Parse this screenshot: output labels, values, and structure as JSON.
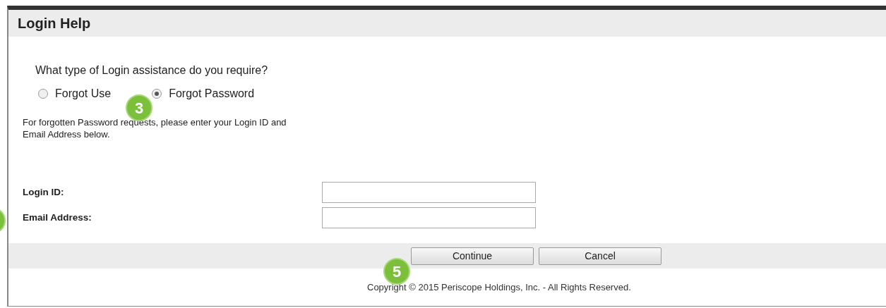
{
  "window": {
    "title": "Login Help"
  },
  "question": "What type of Login assistance do you require?",
  "options": [
    {
      "label": "Forgot Use",
      "selected": false
    },
    {
      "label": "Forgot Password",
      "selected": true
    }
  ],
  "note": "For forgotten Password requests, please enter your Login ID and Email Address below.",
  "fields": [
    {
      "label": "Login ID:"
    },
    {
      "label": "Email Address:"
    }
  ],
  "buttons": [
    "Continue",
    "Cancel"
  ],
  "callouts": [
    {
      "number": "3",
      "kind": "numbered"
    },
    {
      "number": "5",
      "kind": "numbered"
    },
    {
      "kind": "partial"
    }
  ],
  "footer": "Copyright © 2015 Periscope Holdings, Inc. - All Rights Reserved."
}
